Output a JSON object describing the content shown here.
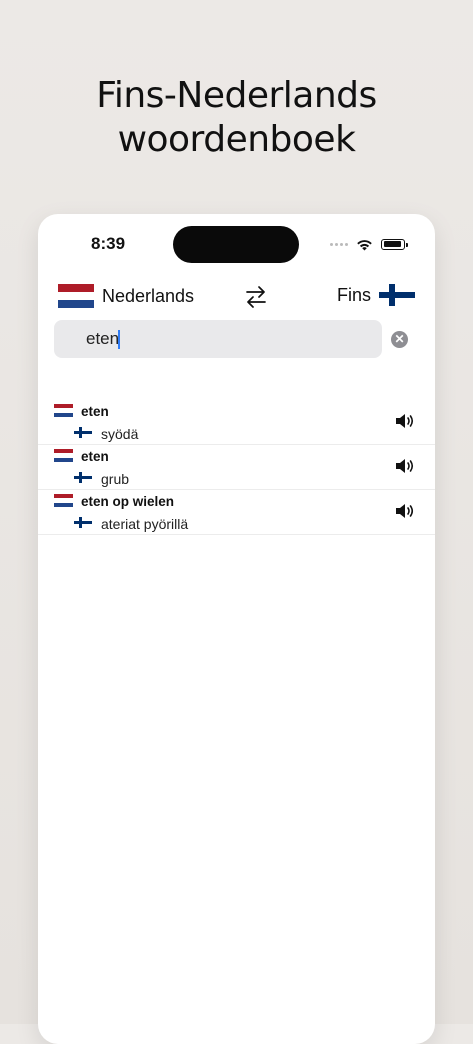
{
  "promo": {
    "line1": "Fins-Nederlands",
    "line2": "woordenboek"
  },
  "status_bar": {
    "time": "8:39"
  },
  "languages": {
    "source_label": "Nederlands",
    "target_label": "Fins",
    "swap_icon": "swap-arrows-icon"
  },
  "search": {
    "value": "eten",
    "clear_icon": "clear-icon"
  },
  "results": [
    {
      "source": "eten",
      "translation": "syödä"
    },
    {
      "source": "eten",
      "translation": "grub"
    },
    {
      "source": "eten op wielen",
      "translation": "ateriat pyörillä"
    }
  ],
  "colors": {
    "nl_red": "#ae1c28",
    "nl_blue": "#21468b",
    "fi_blue": "#002f6c",
    "caret": "#2f7cf6"
  }
}
